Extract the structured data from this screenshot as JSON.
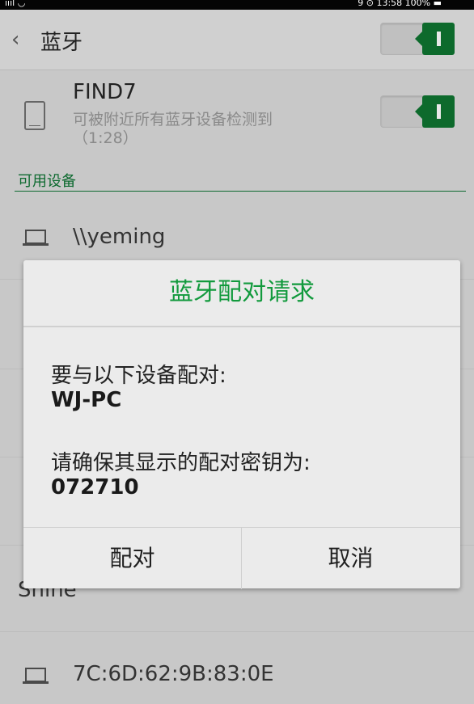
{
  "status_bar": {
    "signal": "ıııl ◡",
    "time": "9 ⊙ 13:58 100% ▬"
  },
  "header": {
    "back_icon": "chevron-left-icon",
    "title": "蓝牙",
    "bluetooth_toggle": "on",
    "accent_color": "#0d6a2c"
  },
  "this_device": {
    "icon": "phone-icon",
    "name": "FIND7",
    "description": "可被附近所有蓝牙设备检测到（1:28）",
    "visibility_toggle": "on"
  },
  "available_devices": {
    "header": "可用设备",
    "items": [
      {
        "icon": "laptop-icon",
        "label": "\\\\yeming"
      },
      {
        "icon": "",
        "label": "Shine"
      },
      {
        "icon": "laptop-icon",
        "label": "7C:6D:62:9B:83:0E"
      }
    ]
  },
  "dialog": {
    "title": "蓝牙配对请求",
    "title_color": "#129a3d",
    "pair_with_label": "要与以下设备配对:",
    "device_name": "WJ-PC",
    "confirm_key_label": "请确保其显示的配对密钥为:",
    "pairing_key": "072710",
    "pair_button": "配对",
    "cancel_button": "取消"
  }
}
